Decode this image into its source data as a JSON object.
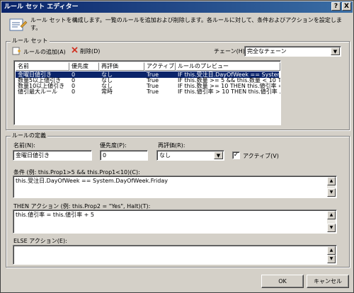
{
  "window": {
    "title": "ルール セット エディター",
    "help_label": "?",
    "close_label": "X"
  },
  "description": "ルール セットを構成します。一覧のルールを追加および削除します。各ルールに対して、条件およびアクションを設定します。",
  "ruleset": {
    "group_label": "ルール セット",
    "add_rule_label": "ルールの追加(A)",
    "delete_label": "削除(D)",
    "chaining_label": "チェーン(H):",
    "chaining_value": "完全なチェーン",
    "columns": [
      "名前",
      "優先度",
      "再評価",
      "アクティブ",
      "ルールのプレビュー"
    ],
    "rows": [
      {
        "name": "金曜日値引き",
        "priority": "0",
        "reevaluation": "なし",
        "active": "True",
        "preview": "IF this.受注日.DayOfWeek == System...."
      },
      {
        "name": "数量5以上値引き",
        "priority": "0",
        "reevaluation": "なし",
        "active": "True",
        "preview": "IF this.数量 >= 5 && this.数量 < 10 THE..."
      },
      {
        "name": "数量10以上値引き",
        "priority": "0",
        "reevaluation": "なし",
        "active": "True",
        "preview": "IF this.数量 >= 10 THEN this.値引率 = ..."
      },
      {
        "name": "値引最大ルール",
        "priority": "0",
        "reevaluation": "常時",
        "active": "True",
        "preview": "IF this.値引率 > 10 THEN this.値引率 ..."
      }
    ],
    "selected_row": 0
  },
  "definition": {
    "group_label": "ルールの定義",
    "name_label": "名前(N):",
    "name_value": "金曜日値引き",
    "priority_label": "優先度(P):",
    "priority_value": "0",
    "reevaluation_label": "再評価(R):",
    "reevaluation_value": "なし",
    "active_label": "アクティブ(V)",
    "active_checked": true,
    "condition_label": "条件 (例: this.Prop1>5 && this.Prop1<10)(C):",
    "condition_value": "this.受注日.DayOfWeek == System.DayOfWeek.Friday",
    "then_label": "THEN アクション (例: this.Prop2 = \"Yes\", Halt)(T):",
    "then_value": "this.値引率 = this.値引率 + 5",
    "else_label": "ELSE アクション(E):",
    "else_value": ""
  },
  "buttons": {
    "ok_label": "OK",
    "cancel_label": "キャンセル"
  },
  "icons": {
    "description": "ruleset-editor-icon",
    "add": "add-rule-icon",
    "delete": "delete-x-icon",
    "dropdown": "chevron-down-icon",
    "scroll_up": "scroll-up-icon",
    "scroll_down": "scroll-down-icon"
  },
  "colors": {
    "title_bar": "#0a246a",
    "selection": "#0a246a",
    "face": "#d4d0c8",
    "delete_icon": "#d03020"
  }
}
